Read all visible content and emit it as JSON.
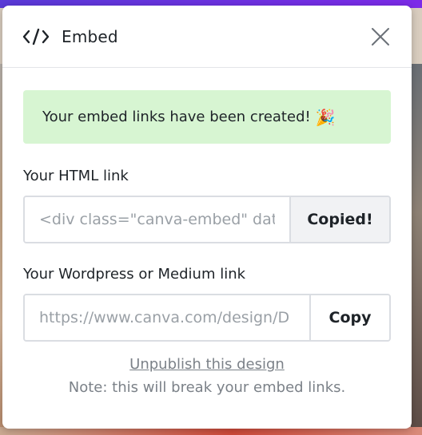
{
  "header": {
    "title": "Embed",
    "code_icon_glyph": "</>",
    "close_icon": "close-icon"
  },
  "banner": {
    "message": "Your embed links have been created!",
    "emoji": "🎉"
  },
  "html_link": {
    "label": "Your HTML link",
    "value": "<div class=\"canva-embed\" dat",
    "button_label": "Copied!"
  },
  "wordpress_link": {
    "label": "Your Wordpress or Medium link",
    "value": "https://www.canva.com/design/D",
    "button_label": "Copy"
  },
  "footer": {
    "unpublish_label": "Unpublish this design",
    "note": "Note: this will break your embed links."
  },
  "colors": {
    "banner_bg": "#d7f5d2",
    "border": "#dadde2",
    "muted_text": "#7b8188"
  }
}
